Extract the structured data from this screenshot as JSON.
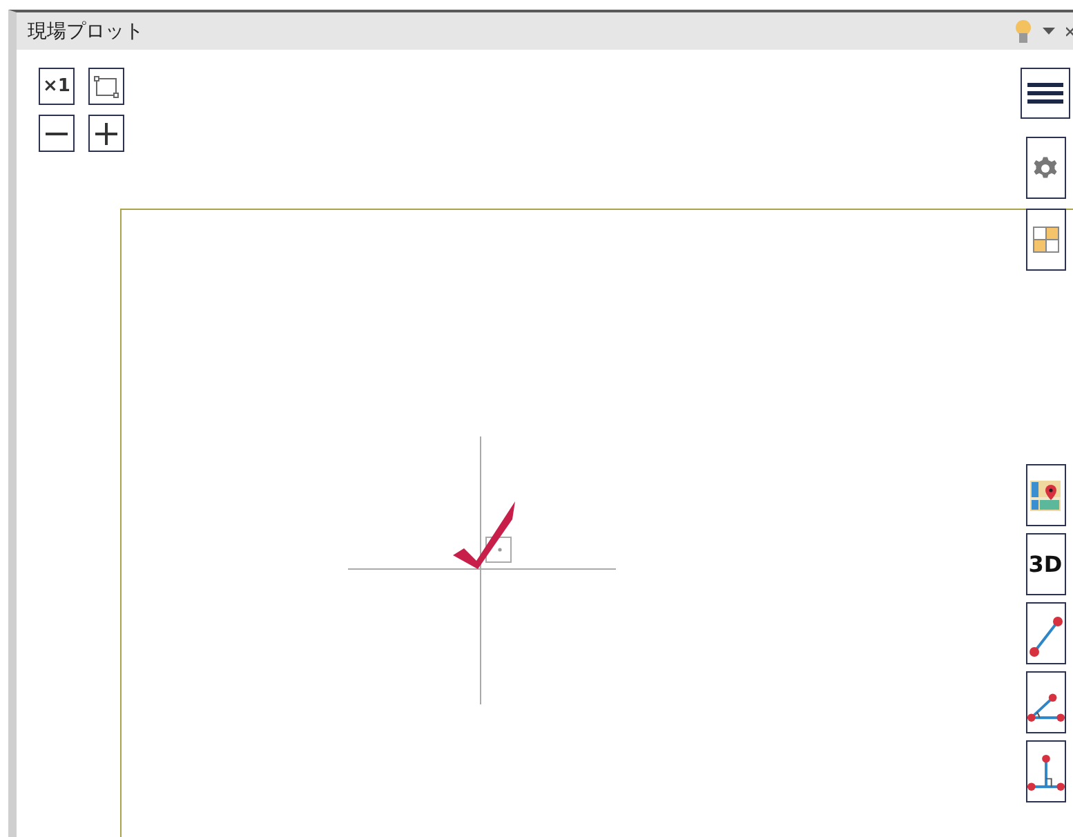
{
  "panel": {
    "title": "現場プロット"
  },
  "view_tools": [
    {
      "kind": "fit",
      "label": "×1"
    },
    {
      "kind": "frame"
    },
    {
      "kind": "zoom-out"
    },
    {
      "kind": "zoom-in"
    }
  ],
  "side_tools": [
    {
      "kind": "menu"
    },
    {
      "kind": "settings"
    },
    {
      "kind": "layout"
    },
    {
      "kind": "gap"
    },
    {
      "kind": "map"
    },
    {
      "kind": "text",
      "label": "3D"
    },
    {
      "kind": "line"
    },
    {
      "kind": "angle"
    },
    {
      "kind": "perpendicular"
    }
  ]
}
